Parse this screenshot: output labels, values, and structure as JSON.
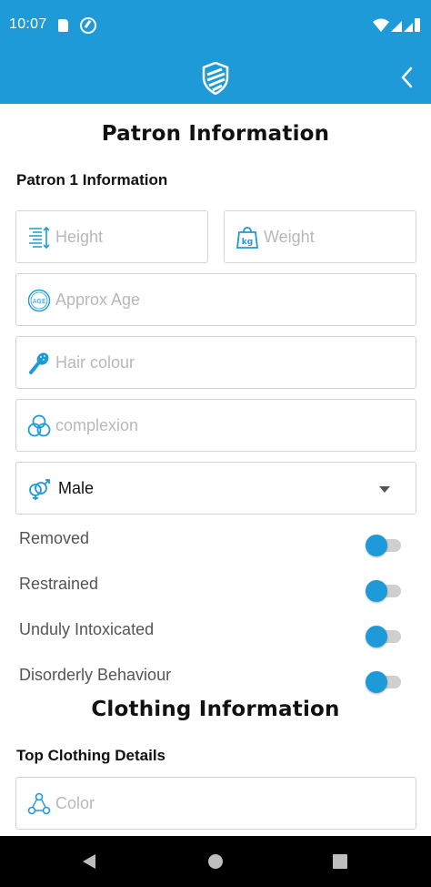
{
  "status_bar": {
    "time": "10:07",
    "icons": [
      "sd-card-icon",
      "vpn-icon",
      "wifi-icon",
      "signal-icon",
      "signal-icon",
      "battery-icon"
    ]
  },
  "app_bar": {
    "logo": "shield-logo-icon",
    "back_icon": "chevron-left-icon",
    "color": "#1e9ad8"
  },
  "patron_section": {
    "title": "Patron Information",
    "subtitle": "Patron 1 Information",
    "fields": {
      "height": {
        "icon": "height-ruler-icon",
        "placeholder": "Height"
      },
      "weight": {
        "icon": "weight-kg-icon",
        "placeholder": "Weight"
      },
      "age": {
        "icon": "age-badge-icon",
        "placeholder": "Approx Age"
      },
      "hair": {
        "icon": "hairbrush-icon",
        "placeholder": "Hair colour"
      },
      "complexion": {
        "icon": "complexion-circles-icon",
        "placeholder": "complexion"
      }
    },
    "gender": {
      "icon": "gender-icon",
      "selected": "Male"
    },
    "toggles": [
      {
        "label": "Removed",
        "on": true
      },
      {
        "label": "Restrained",
        "on": true
      },
      {
        "label": "Unduly Intoxicated",
        "on": true
      },
      {
        "label": "Disorderly Behaviour",
        "on": true
      }
    ]
  },
  "clothing_section": {
    "title": "Clothing Information",
    "subtitle": "Top Clothing Details",
    "fields": {
      "color": {
        "icon": "color-circles-icon",
        "placeholder": "Color"
      }
    }
  },
  "nav_bar": {
    "back": "nav-back-icon",
    "home": "nav-home-icon",
    "recents": "nav-recents-icon"
  }
}
